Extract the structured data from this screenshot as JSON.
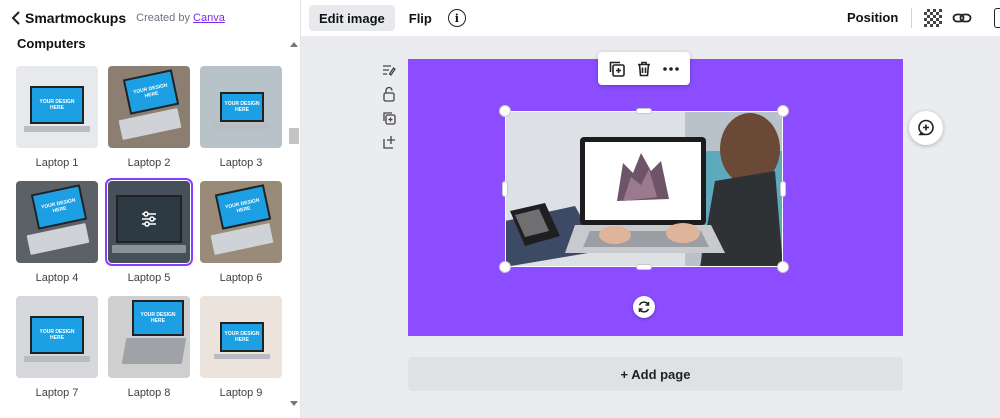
{
  "sidebar": {
    "app_name": "Smartmockups",
    "created_by_prefix": "Created by",
    "created_by_link": "Canva",
    "section_title": "Computers",
    "screen_text": "YOUR DESIGN HERE",
    "items": [
      {
        "label": "Laptop 1",
        "bg": "#e7e9ec",
        "style": "front"
      },
      {
        "label": "Laptop 2",
        "bg": "#8c7f72",
        "style": "hands"
      },
      {
        "label": "Laptop 3",
        "bg": "#b8c3c9",
        "style": "desk"
      },
      {
        "label": "Laptop 4",
        "bg": "#5c6168",
        "style": "hands"
      },
      {
        "label": "Laptop 5",
        "bg": "#46505a",
        "style": "selected",
        "selected": true
      },
      {
        "label": "Laptop 6",
        "bg": "#9a8a78",
        "style": "hands"
      },
      {
        "label": "Laptop 7",
        "bg": "#d5d7da",
        "style": "front"
      },
      {
        "label": "Laptop 8",
        "bg": "#cfcfcf",
        "style": "top"
      },
      {
        "label": "Laptop 9",
        "bg": "#ece3dc",
        "style": "desk"
      }
    ]
  },
  "topbar": {
    "edit_image": "Edit image",
    "flip": "Flip",
    "info": "i",
    "position": "Position"
  },
  "canvas": {
    "page_color": "#8b4dff",
    "add_page": "+ Add page"
  }
}
